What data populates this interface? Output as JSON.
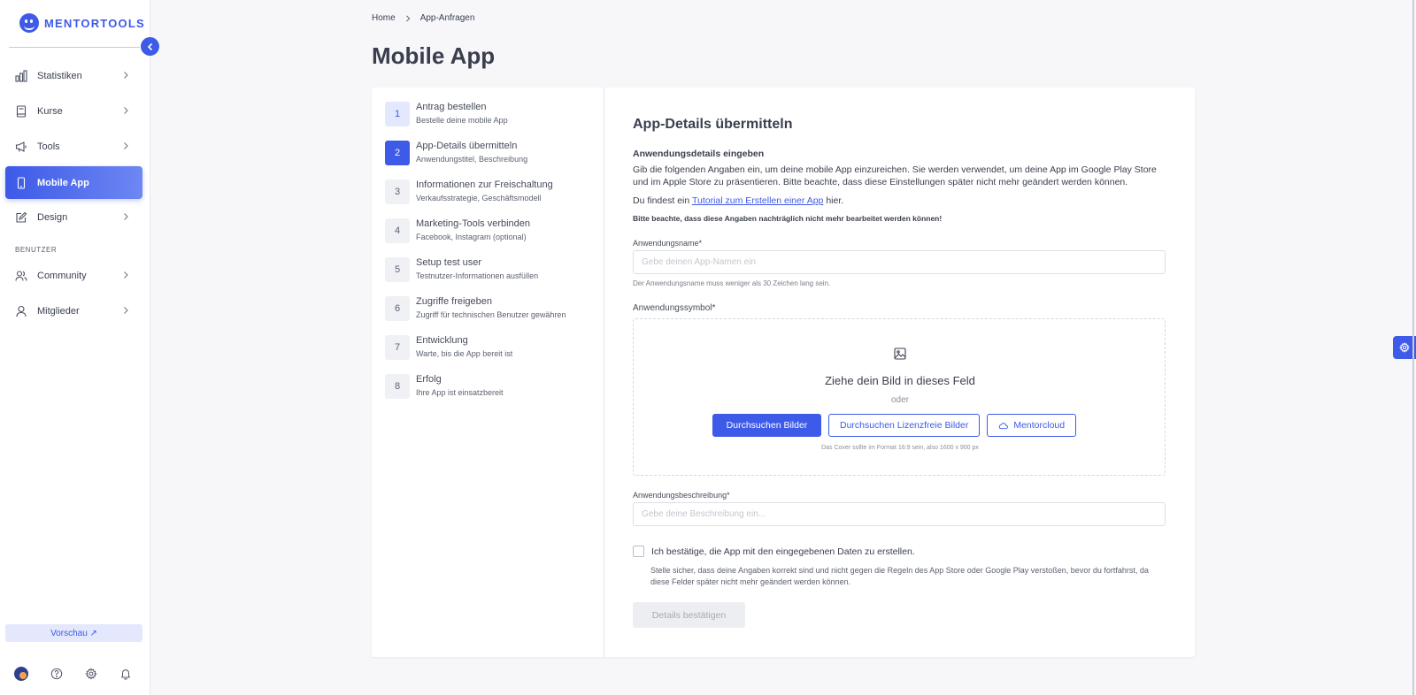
{
  "brand": {
    "name": "MENTORTOOLS",
    "accent": "#3d5ae8"
  },
  "sidebar": {
    "items": [
      {
        "label": "Statistiken",
        "icon": "bar-chart-icon"
      },
      {
        "label": "Kurse",
        "icon": "book-icon"
      },
      {
        "label": "Tools",
        "icon": "megaphone-icon"
      },
      {
        "label": "Mobile App",
        "icon": "smartphone-icon",
        "active": true
      },
      {
        "label": "Design",
        "icon": "pencil-icon"
      }
    ],
    "section_label": "BENUTZER",
    "user_items": [
      {
        "label": "Community",
        "icon": "users-icon"
      },
      {
        "label": "Mitglieder",
        "icon": "user-icon"
      }
    ],
    "preview_label": "Vorschau ↗"
  },
  "breadcrumb": {
    "home": "Home",
    "current": "App-Anfragen"
  },
  "page_title": "Mobile App",
  "steps": [
    {
      "num": "1",
      "title": "Antrag bestellen",
      "sub": "Bestelle deine mobile App",
      "state": "done"
    },
    {
      "num": "2",
      "title": "App-Details übermitteln",
      "sub": "Anwendungstitel, Beschreibung",
      "state": "current"
    },
    {
      "num": "3",
      "title": "Informationen zur Freischaltung",
      "sub": "Verkaufsstrategie, Geschäftsmodell",
      "state": "pending"
    },
    {
      "num": "4",
      "title": "Marketing-Tools verbinden",
      "sub": "Facebook, Instagram (optional)",
      "state": "pending"
    },
    {
      "num": "5",
      "title": "Setup test user",
      "sub": "Testnutzer-Informationen ausfüllen",
      "state": "pending"
    },
    {
      "num": "6",
      "title": "Zugriffe freigeben",
      "sub": "Zugriff für technischen Benutzer gewähren",
      "state": "pending"
    },
    {
      "num": "7",
      "title": "Entwicklung",
      "sub": "Warte, bis die App bereit ist",
      "state": "pending"
    },
    {
      "num": "8",
      "title": "Erfolg",
      "sub": "Ihre App ist einsatzbereit",
      "state": "pending"
    }
  ],
  "form": {
    "title": "App-Details übermitteln",
    "subtitle": "Anwendungsdetails eingeben",
    "intro": "Gib die folgenden Angaben ein, um deine mobile App einzureichen. Sie werden verwendet, um deine App im Google Play Store und im Apple Store zu präsentieren. Bitte beachte, dass diese Einstellungen später nicht mehr geändert werden können.",
    "tutorial_prefix": "Du findest ein",
    "tutorial_link": "Tutorial zum Erstellen einer App",
    "tutorial_suffix": "hier.",
    "warning": "Bitte beachte, dass diese Angaben nachträglich nicht mehr bearbeitet werden können!",
    "name_label": "Anwendungsname*",
    "name_placeholder": "Gebe deinen App-Namen ein",
    "name_value": "",
    "name_hint": "Der Anwendungsname muss weniger als 30 Zeichen lang sein.",
    "symbol_label": "Anwendungssymbol*",
    "dropzone_title": "Ziehe dein Bild in dieses Feld",
    "dropzone_or": "oder",
    "browse_label": "Durchsuchen Bilder",
    "browse_free_label": "Durchsuchen Lizenzfreie Bilder",
    "mentorcloud_label": "Mentorcloud",
    "dropzone_hint": "Das Cover sollte im Format 16:9 sein, also 1600 x 900 px",
    "description_label": "Anwendungsbeschreibung*",
    "description_placeholder": "Gebe deine Beschreibung ein...",
    "description_value": "",
    "confirm_label": "Ich bestätige, die App mit den eingegebenen Daten zu erstellen.",
    "confirm_checked": false,
    "confirm_hint": "Stelle sicher, dass deine Angaben korrekt sind und nicht gegen die Regeln des App Store oder Google Play verstoßen, bevor du fortfahrst, da diese Felder später nicht mehr geändert werden können.",
    "submit_label": "Details bestätigen"
  }
}
